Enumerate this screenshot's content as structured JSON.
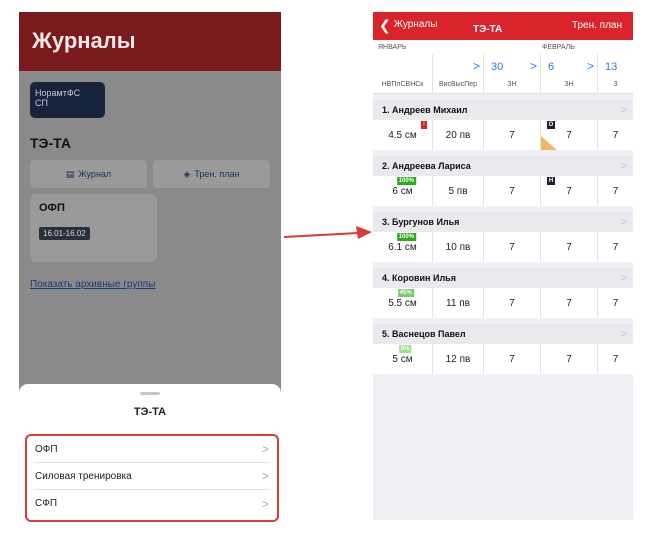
{
  "left_screen": {
    "title": "Журналы",
    "group_chip": [
      "НорамтФС",
      "СП"
    ],
    "section_title": "ТЭ-ТА",
    "tabs": [
      {
        "icon": "journal-icon",
        "glyph": "▤",
        "label": "Журнал"
      },
      {
        "icon": "plan-icon",
        "glyph": "◈",
        "label": "Трен. план"
      }
    ],
    "card": {
      "title": "ОФП",
      "dates": "16.01-16.02"
    },
    "archive_link": "Показать архивные группы",
    "sheet": {
      "title": "ТЭ-ТА",
      "items": [
        {
          "label": "ОФП",
          "chevron": ">"
        },
        {
          "label": "Силовая тренировка",
          "chevron": ">"
        },
        {
          "label": "СФП",
          "chevron": ">"
        }
      ]
    }
  },
  "right_screen": {
    "nav": {
      "back": "Журналы",
      "back_glyph": "❮",
      "title": "ТЭ-ТА",
      "plan": "Трен. план"
    },
    "months": {
      "first": "ЯНВАРЬ",
      "second": "ФЕВРАЛЬ"
    },
    "dates": {
      "col2_arrow": ">",
      "col3_num": "30",
      "col3_arrow": ">",
      "col4_num": "6",
      "col4_arrow": ">",
      "col5_num": "13"
    },
    "column_heads": [
      "НВПлСВНСк",
      "ВисВысПер",
      "ЗН",
      "ЗН",
      "З"
    ],
    "athletes": [
      {
        "name": "1. Андреев Михаил",
        "chevron": ">",
        "cells": [
          "4.5 см",
          "20 пв",
          "7",
          "7",
          "7"
        ],
        "badge": null,
        "flag": "!",
        "mark": "О",
        "triangle": true
      },
      {
        "name": "2. Андреева Лариса",
        "chevron": ">",
        "cells": [
          "6 см",
          "5 пв",
          "7",
          "7",
          "7"
        ],
        "badge": {
          "text": "100%",
          "color": "#2daa1d"
        },
        "flag": null,
        "mark": "Н",
        "triangle": false
      },
      {
        "name": "3. Бургунов Илья",
        "chevron": ">",
        "cells": [
          "6.1 см",
          "10 пв",
          "7",
          "7",
          "7"
        ],
        "badge": {
          "text": "100%",
          "color": "#2daa1d"
        },
        "flag": null,
        "mark": null,
        "triangle": false
      },
      {
        "name": "4. Коровин Илья",
        "chevron": ">",
        "cells": [
          "5.5 см",
          "11 пв",
          "7",
          "7",
          "7"
        ],
        "badge": {
          "text": "45%",
          "color": "#7acc6a"
        },
        "flag": null,
        "mark": null,
        "triangle": false
      },
      {
        "name": "5. Васнецов Павел",
        "chevron": ">",
        "cells": [
          "5 см",
          "12 пв",
          "7",
          "7",
          "7"
        ],
        "badge": {
          "text": "0%",
          "color": "#9ee08f"
        },
        "flag": null,
        "mark": null,
        "triangle": false
      }
    ]
  },
  "colors": {
    "nav_red": "#d8242a",
    "highlight_red": "#d93a3a",
    "link_blue": "#2f7de1",
    "dim_header": "#7a1a1c"
  }
}
